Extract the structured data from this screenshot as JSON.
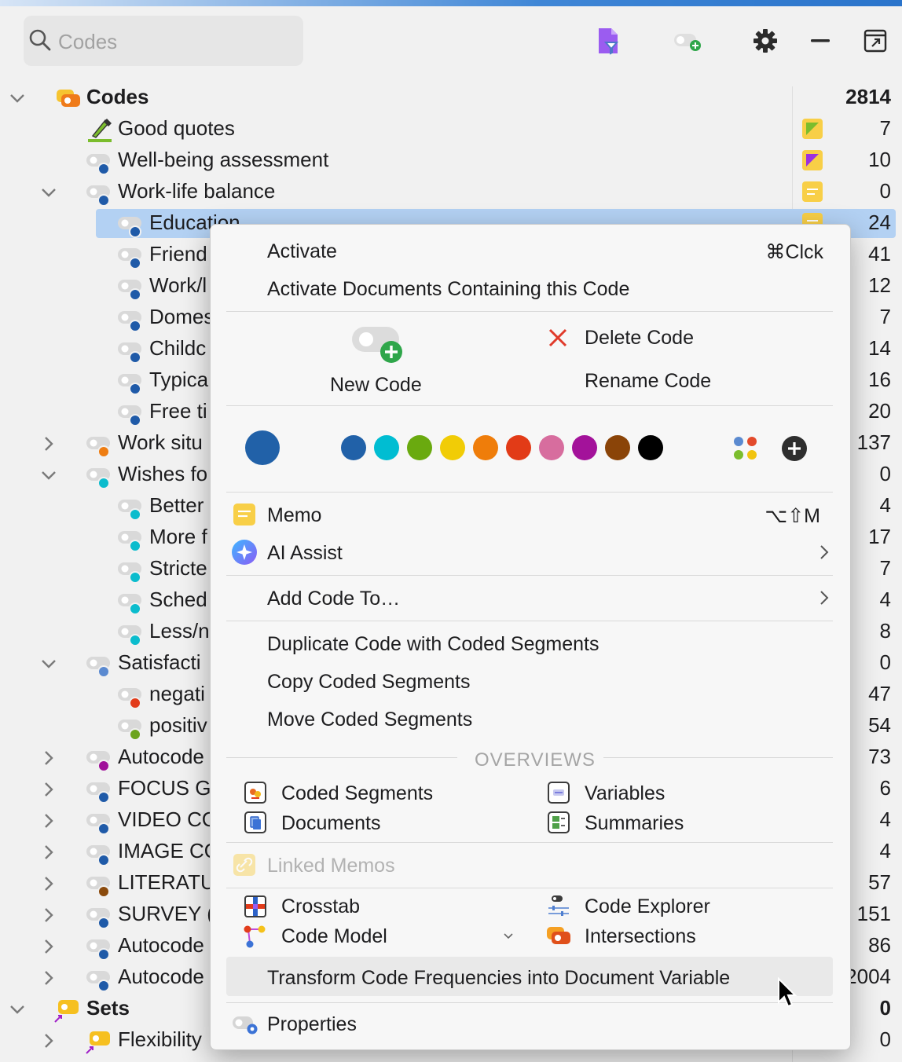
{
  "search": {
    "placeholder": "Codes"
  },
  "toolbar": {
    "icons": [
      "filter-doc-icon",
      "new-code-icon",
      "gear-icon",
      "minimize-icon",
      "popout-icon"
    ]
  },
  "tree": {
    "root": {
      "label": "Codes",
      "count": "2814"
    },
    "items": [
      {
        "label": "Good quotes",
        "count": "7",
        "dot": "#6ca41e"
      },
      {
        "label": "Well-being assessment",
        "count": "10",
        "dot": "#1f5aa8"
      },
      {
        "label": "Work-life balance",
        "count": "0",
        "dot": "#1f5aa8"
      },
      {
        "label": "Education",
        "count": "24",
        "dot": "#1f5aa8"
      },
      {
        "label": "Friend",
        "count": "41",
        "dot": "#1f5aa8"
      },
      {
        "label": "Work/l",
        "count": "12",
        "dot": "#1f5aa8"
      },
      {
        "label": "Domes",
        "count": "7",
        "dot": "#1f5aa8"
      },
      {
        "label": "Childc",
        "count": "14",
        "dot": "#1f5aa8"
      },
      {
        "label": "Typica",
        "count": "16",
        "dot": "#1f5aa8"
      },
      {
        "label": "Free ti",
        "count": "20",
        "dot": "#1f5aa8"
      },
      {
        "label": "Work situ",
        "count": "137",
        "dot": "#ee7d12"
      },
      {
        "label": "Wishes fo",
        "count": "0",
        "dot": "#0bbccd"
      },
      {
        "label": "Better",
        "count": "4",
        "dot": "#0bbccd"
      },
      {
        "label": "More f",
        "count": "17",
        "dot": "#0bbccd"
      },
      {
        "label": "Stricte",
        "count": "7",
        "dot": "#0bbccd"
      },
      {
        "label": "Sched",
        "count": "4",
        "dot": "#0bbccd"
      },
      {
        "label": "Less/n",
        "count": "8",
        "dot": "#0bbccd"
      },
      {
        "label": "Satisfacti",
        "count": "0",
        "dot": "#5b8ad0"
      },
      {
        "label": "negati",
        "count": "47",
        "dot": "#e23c1b"
      },
      {
        "label": "positiv",
        "count": "54",
        "dot": "#6ca41e"
      },
      {
        "label": "Autocode",
        "count": "73",
        "dot": "#a0119a"
      },
      {
        "label": "FOCUS G",
        "count": "6",
        "dot": "#1f5aa8"
      },
      {
        "label": "VIDEO CO",
        "count": "4",
        "dot": "#1f5aa8"
      },
      {
        "label": "IMAGE CO",
        "count": "4",
        "dot": "#1f5aa8"
      },
      {
        "label": "LITERATU",
        "count": "57",
        "dot": "#8a4a0c"
      },
      {
        "label": "SURVEY (",
        "count": "151",
        "dot": "#1f5aa8"
      },
      {
        "label": "Autocode",
        "count": "86",
        "dot": "#1f5aa8"
      },
      {
        "label": "Autocode",
        "count": "2004",
        "dot": "#1f5aa8"
      }
    ],
    "sets": {
      "label": "Sets",
      "count": "0"
    },
    "sets_items": [
      {
        "label": "Flexibility",
        "count": "0"
      }
    ]
  },
  "menu": {
    "activate": "Activate",
    "activate_shortcut": "⌘Clck",
    "activate_docs": "Activate Documents Containing this Code",
    "new_code": "New Code",
    "delete_code": "Delete Code",
    "rename_code": "Rename Code",
    "colors": {
      "current": "#2161a8",
      "palette": [
        "#2161a8",
        "#00bdd2",
        "#6aaa0f",
        "#f1cc06",
        "#ef7d0a",
        "#e23b17",
        "#d76d9e",
        "#a3129a",
        "#8a4408",
        "#000000"
      ]
    },
    "memo": "Memo",
    "memo_shortcut": "⌥⇧M",
    "ai_assist": "AI Assist",
    "add_code_to": "Add Code To…",
    "duplicate": "Duplicate Code with Coded Segments",
    "copy_segments": "Copy Coded Segments",
    "move_segments": "Move Coded Segments",
    "overviews_title": "OVERVIEWS",
    "coded_segments": "Coded Segments",
    "variables": "Variables",
    "documents": "Documents",
    "summaries": "Summaries",
    "linked_memos": "Linked Memos",
    "crosstab": "Crosstab",
    "code_explorer": "Code Explorer",
    "code_model": "Code Model",
    "intersections": "Intersections",
    "transform": "Transform Code Frequencies into Document Variable",
    "properties": "Properties"
  }
}
